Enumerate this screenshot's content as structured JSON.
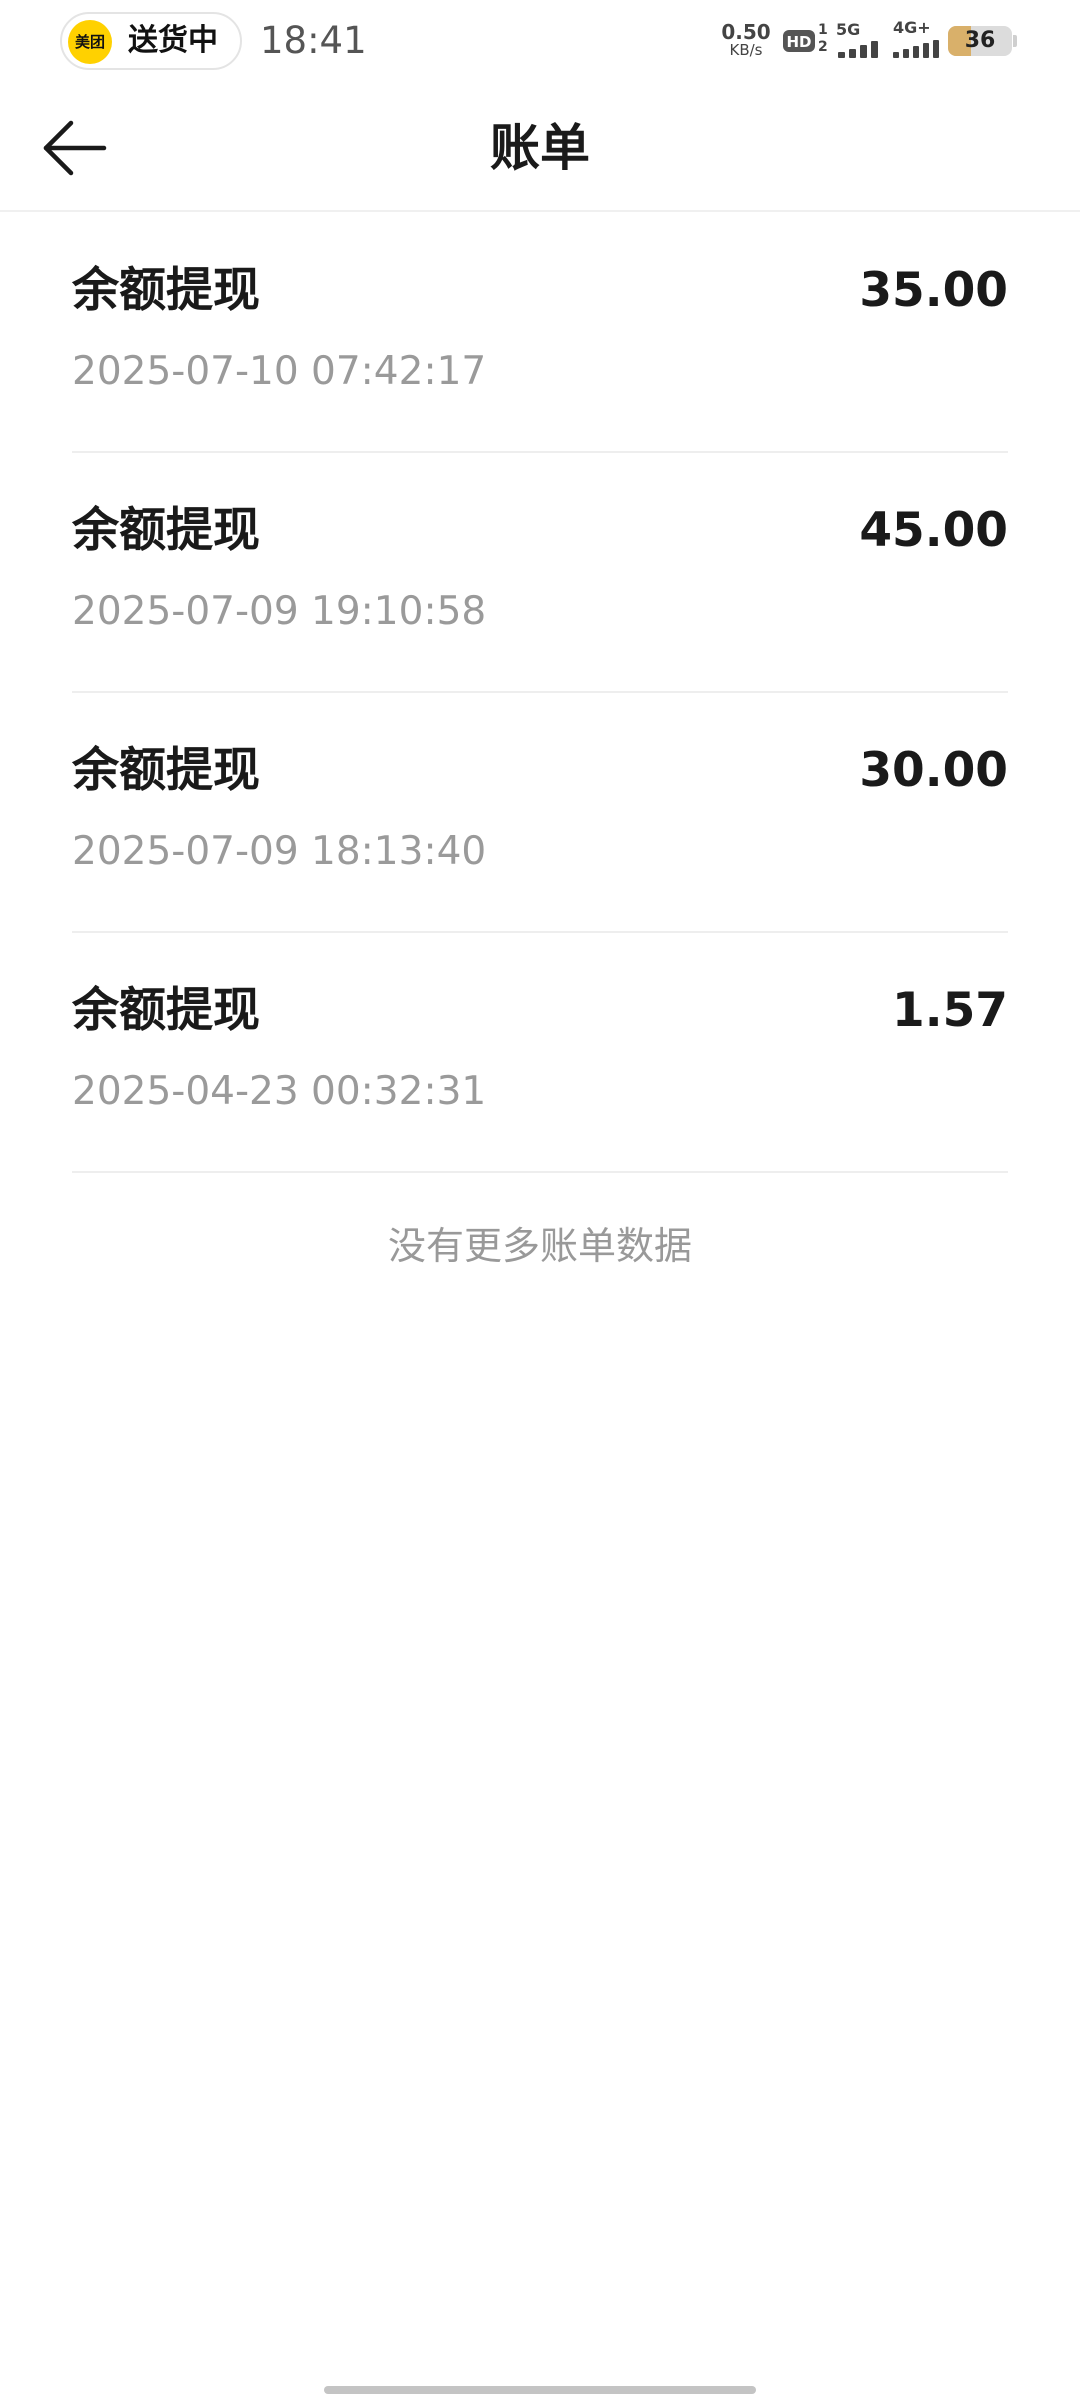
{
  "status_bar": {
    "app_logo_text": "美团",
    "delivery_status": "送货中",
    "time": "18:41",
    "net_speed_value": "0.50",
    "net_speed_unit": "KB/s",
    "hd_label": "HD",
    "sim_digits_top": "1",
    "sim_digits_bottom": "2",
    "network_1": "5G",
    "network_2": "4G+",
    "battery_level": "36",
    "battery_fraction": 0.36,
    "colors": {
      "logo": "#ffd100",
      "battery_fill": "#d9b06a"
    }
  },
  "header": {
    "back_icon": "arrow-left-icon",
    "title": "账单"
  },
  "bills": [
    {
      "title": "余额提现",
      "amount": "35.00",
      "time": "2025-07-10 07:42:17"
    },
    {
      "title": "余额提现",
      "amount": "45.00",
      "time": "2025-07-09 19:10:58"
    },
    {
      "title": "余额提现",
      "amount": "30.00",
      "time": "2025-07-09 18:13:40"
    },
    {
      "title": "余额提现",
      "amount": "1.57",
      "time": "2025-04-23 00:32:31"
    }
  ],
  "footer": {
    "no_more_text": "没有更多账单数据"
  }
}
